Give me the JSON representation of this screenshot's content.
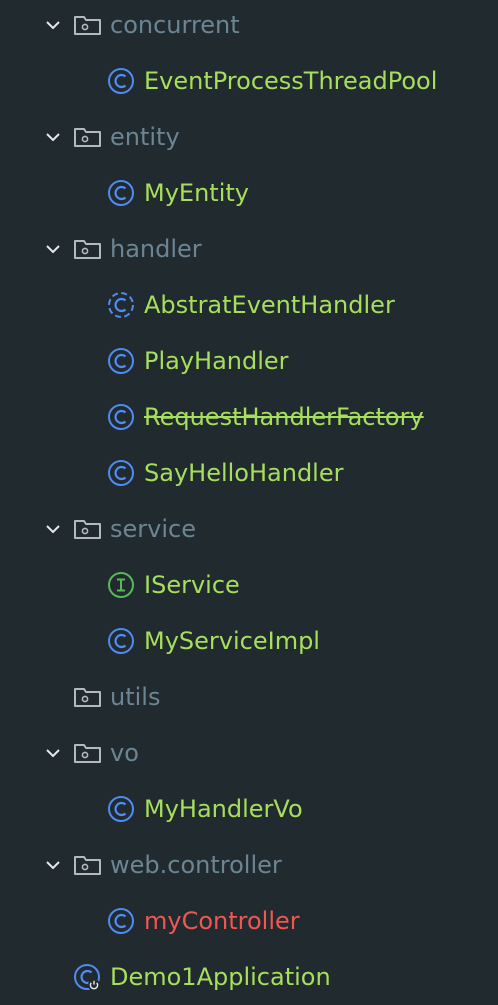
{
  "colors": {
    "background": "#212a2f",
    "package_text": "#6c8593",
    "class_text": "#a6df5b",
    "error_text": "#f2564e",
    "class_icon": "#4f8bf0",
    "interface_icon": "#58b85a"
  },
  "tree": {
    "packages": [
      {
        "name": "concurrent",
        "expanded": true,
        "icon": "folder-icon",
        "children": [
          {
            "name": "EventProcessThreadPool",
            "kind": "class",
            "icon": "class-icon"
          }
        ]
      },
      {
        "name": "entity",
        "expanded": true,
        "icon": "folder-icon",
        "children": [
          {
            "name": "MyEntity",
            "kind": "class",
            "icon": "class-icon"
          }
        ]
      },
      {
        "name": "handler",
        "expanded": true,
        "icon": "folder-icon",
        "children": [
          {
            "name": "AbstratEventHandler",
            "kind": "abstract-class",
            "icon": "abstract-class-icon"
          },
          {
            "name": "PlayHandler",
            "kind": "class",
            "icon": "class-icon"
          },
          {
            "name": "RequestHandlerFactory",
            "kind": "class",
            "icon": "class-icon",
            "deprecated": true
          },
          {
            "name": "SayHelloHandler",
            "kind": "class",
            "icon": "class-icon"
          }
        ]
      },
      {
        "name": "service",
        "expanded": true,
        "icon": "folder-icon",
        "children": [
          {
            "name": "IService",
            "kind": "interface",
            "icon": "interface-icon"
          },
          {
            "name": "MyServiceImpl",
            "kind": "class",
            "icon": "class-icon"
          }
        ]
      },
      {
        "name": "utils",
        "expanded": false,
        "icon": "folder-icon",
        "children": []
      },
      {
        "name": "vo",
        "expanded": true,
        "icon": "folder-icon",
        "children": [
          {
            "name": "MyHandlerVo",
            "kind": "class",
            "icon": "class-icon"
          }
        ]
      },
      {
        "name": "web.controller",
        "expanded": true,
        "icon": "folder-icon",
        "children": [
          {
            "name": "myController",
            "kind": "class",
            "icon": "class-icon",
            "error": true
          }
        ]
      }
    ],
    "application": {
      "name": "Demo1Application",
      "kind": "spring-boot-application",
      "icon": "spring-boot-class-icon"
    }
  }
}
